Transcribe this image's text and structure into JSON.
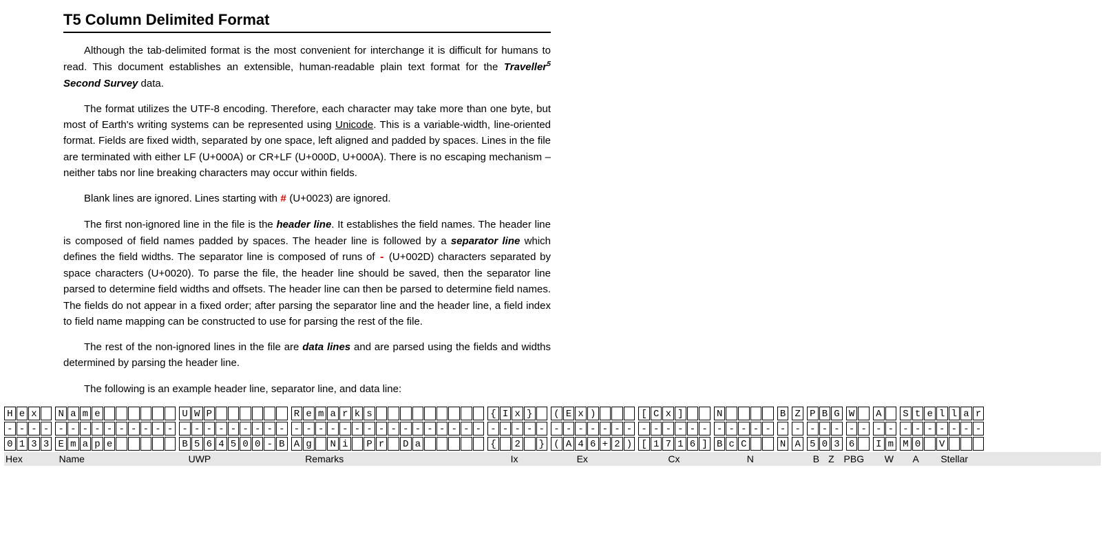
{
  "title": "T5 Column Delimited Format",
  "p1a": "Although the tab-delimited format is the most convenient for interchange it is difficult for humans to read. This document establishes an extensible, human-readable plain text format for the ",
  "p1_trav": "Traveller",
  "p1_sup": "5",
  "p1_ss": " Second Survey",
  "p1b": " data.",
  "p2a": "The format utilizes the UTF-8 encoding. Therefore, each character may take more than one byte, but most of Earth's writing systems can be represented using ",
  "p2_link": "Unicode",
  "p2b": ". This is a variable-width, line-oriented format. Fields are fixed width, separated by one space, left aligned and padded by spaces. Lines in the file are terminated with either LF (U+000A) or CR+LF (U+000D, U+000A). There is no escaping mechanism – neither tabs nor line breaking characters may occur within fields.",
  "p3a": "Blank lines are ignored. Lines starting with ",
  "p3_hash": "#",
  "p3b": " (U+0023) are ignored.",
  "p4a": "The first non-ignored line in the file is the ",
  "p4_hl": "header line",
  "p4b": ". It establishes the field names. The header line is composed of field names padded by spaces. The header line is followed by a ",
  "p4_sl": "separator line",
  "p4c": " which defines the field widths. The separator line is composed of runs of ",
  "p4_dash": "-",
  "p4d": " (U+002D) characters separated by space characters (U+0020). To parse the file, the header line should be saved, then the separator line parsed to determine field widths and offsets. The header line can then be parsed to determine field names. The fields do not appear in a fixed order; after parsing the separator line and the header line, a field index to field name mapping can be constructed to use for parsing the rest of the file.",
  "p5a": "The rest of the non-ignored lines in the file are ",
  "p5_dl": "data lines",
  "p5b": " and are parsed using the fields and widths determined by parsing the header line.",
  "p6": "The following is an example header line, separator line, and data line:",
  "grid": {
    "cellW": 18.4,
    "fields": [
      {
        "name": "Hex",
        "w": 4
      },
      {
        "name": "Name",
        "w": 10
      },
      {
        "name": "UWP",
        "w": 9
      },
      {
        "name": "Remarks",
        "w": 16
      },
      {
        "name": "Ix",
        "w": 5
      },
      {
        "name": "Ex",
        "w": 7
      },
      {
        "name": "Cx",
        "w": 6
      },
      {
        "name": "N",
        "w": 5
      },
      {
        "name": "B",
        "w": 1
      },
      {
        "name": "Z",
        "w": 1
      },
      {
        "name": "PBG",
        "w": 3
      },
      {
        "name": "W",
        "w": 2
      },
      {
        "name": "A",
        "w": 2
      },
      {
        "name": "Stellar",
        "w": 7
      }
    ],
    "rows": [
      [
        "Hex ",
        "Name      ",
        "UWP      ",
        "Remarks         ",
        "{Ix} ",
        "(Ex)   ",
        "[Cx]  ",
        "N    ",
        "B",
        "Z",
        "PBG",
        "W ",
        "A ",
        "Stellar"
      ],
      [
        "----",
        "----------",
        "---------",
        "----------------",
        "-----",
        "-------",
        "------",
        "-----",
        "-",
        "-",
        "---",
        "--",
        "--",
        "-------"
      ],
      [
        "0133",
        "Emape     ",
        "B564500-B",
        "Ag Ni Pr Da     ",
        "{ 2 }",
        "(A46+2)",
        "[1716]",
        "BcC  ",
        "N",
        "A",
        "503",
        "6 ",
        "Im",
        "M0 V   "
      ]
    ]
  }
}
